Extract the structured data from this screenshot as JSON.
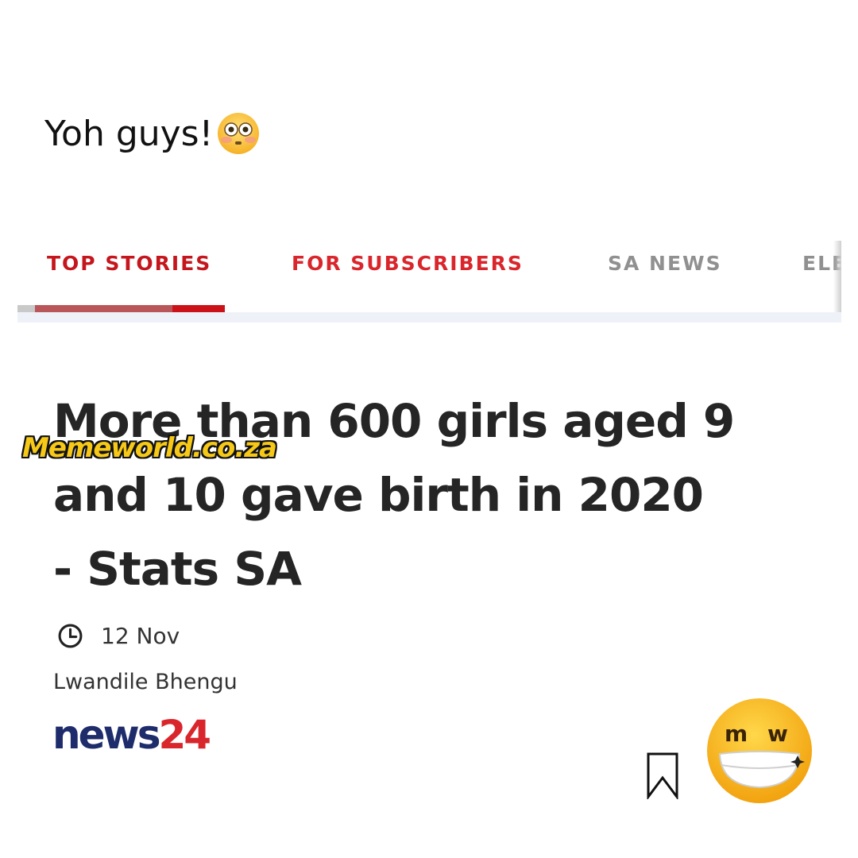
{
  "caption": {
    "text": "Yoh guys!",
    "emoji_icon": "flushed-face-icon"
  },
  "tabs": [
    {
      "label": "TOP STORIES",
      "active": true,
      "color": "#c4161c"
    },
    {
      "label": "FOR SUBSCRIBERS",
      "active": false,
      "color": "#d9262c"
    },
    {
      "label": "SA NEWS",
      "active": false,
      "color": "#909090"
    },
    {
      "label": "ELE",
      "active": false,
      "color": "#909090"
    }
  ],
  "article": {
    "headline": "More than 600 girls aged 9 and 10 gave birth in 2020 - Stats SA",
    "date": "12 Nov",
    "author": "Lwandile Bhengu",
    "publisher_logo": {
      "part1": "news",
      "part2": "24"
    }
  },
  "watermark": "Memeworld.co.za",
  "icons": {
    "clock": "clock-icon",
    "bookmark": "bookmark-icon",
    "mascot": "memeworld-mascot-icon"
  },
  "colors": {
    "accent_red": "#cc1219",
    "inactive_tab": "#909090",
    "logo_navy": "#1f2c6b",
    "watermark_yellow": "#f6c817"
  }
}
